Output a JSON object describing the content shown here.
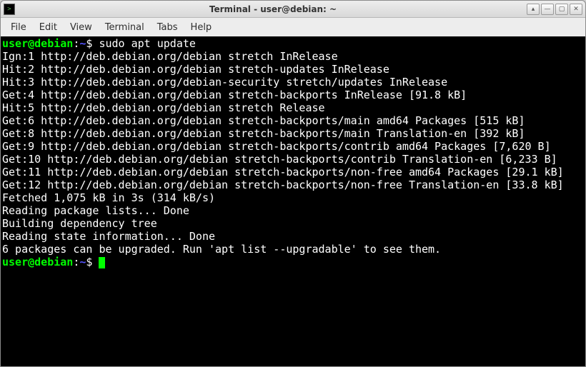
{
  "window": {
    "title": "Terminal - user@debian: ~"
  },
  "menubar": {
    "items": [
      "File",
      "Edit",
      "View",
      "Terminal",
      "Tabs",
      "Help"
    ]
  },
  "prompt": {
    "userhost": "user@debian",
    "sep1": ":",
    "path": "~",
    "sigil": "$"
  },
  "command": "sudo apt update",
  "output_lines": [
    "Ign:1 http://deb.debian.org/debian stretch InRelease",
    "Hit:2 http://deb.debian.org/debian stretch-updates InRelease",
    "Hit:3 http://deb.debian.org/debian-security stretch/updates InRelease",
    "Get:4 http://deb.debian.org/debian stretch-backports InRelease [91.8 kB]",
    "Hit:5 http://deb.debian.org/debian stretch Release",
    "Get:6 http://deb.debian.org/debian stretch-backports/main amd64 Packages [515 kB]",
    "Get:8 http://deb.debian.org/debian stretch-backports/main Translation-en [392 kB]",
    "Get:9 http://deb.debian.org/debian stretch-backports/contrib amd64 Packages [7,620 B]",
    "Get:10 http://deb.debian.org/debian stretch-backports/contrib Translation-en [6,233 B]",
    "Get:11 http://deb.debian.org/debian stretch-backports/non-free amd64 Packages [29.1 kB]",
    "Get:12 http://deb.debian.org/debian stretch-backports/non-free Translation-en [33.8 kB]",
    "Fetched 1,075 kB in 3s (314 kB/s)",
    "Reading package lists... Done",
    "Building dependency tree",
    "Reading state information... Done",
    "6 packages can be upgraded. Run 'apt list --upgradable' to see them."
  ],
  "titlebar_buttons": {
    "stick": "▴",
    "min": "—",
    "max": "▢",
    "close": "✕"
  }
}
